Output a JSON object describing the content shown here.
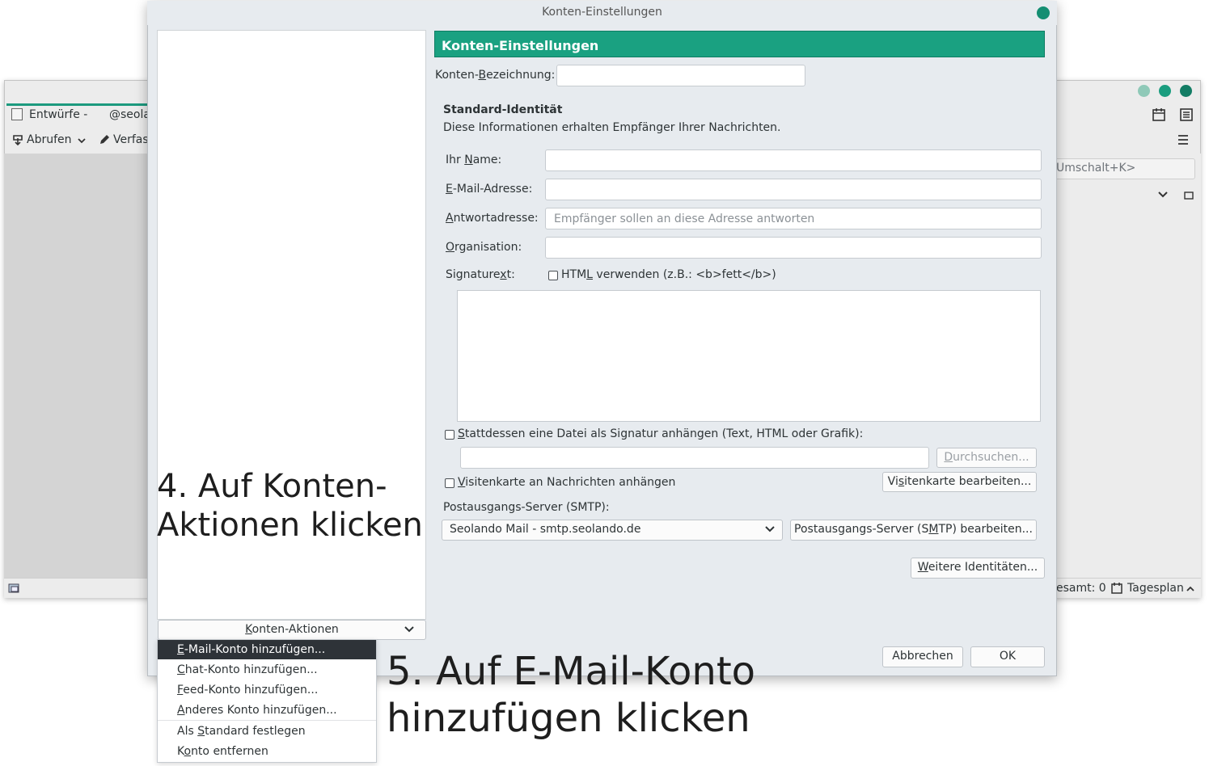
{
  "background_window": {
    "tab_label": "Entwürfe - ",
    "tab_account": "@seola",
    "fetch_label": "Abrufen",
    "compose_label": "Verfas",
    "search_hint": "Umschalt+K>",
    "footer_total": "esamt: 0",
    "footer_today": "Tagesplan"
  },
  "dialog": {
    "title": "Konten-Einstellungen",
    "header": "Konten-Einstellungen",
    "account_name_label_pre": "Konten-",
    "account_name_label_u": "B",
    "account_name_label_post": "ezeichnung:",
    "account_name_value": "",
    "identity_heading": "Standard-Identität",
    "identity_desc": "Diese Informationen erhalten Empfänger Ihrer Nachrichten.",
    "name_label_pre": "Ihr ",
    "name_label_u": "N",
    "name_label_post": "ame:",
    "name_value": "",
    "email_label_u": "E",
    "email_label_post": "-Mail-Adresse:",
    "email_value": "",
    "reply_label_u": "A",
    "reply_label_post": "ntwortadresse:",
    "reply_placeholder": "Empfänger sollen an diese Adresse antworten",
    "org_label_u": "O",
    "org_label_post": "rganisation:",
    "org_value": "",
    "sig_label_pre": "Signature",
    "sig_label_u": "x",
    "sig_label_post": "t:",
    "html_checkbox_pre": "HTM",
    "html_checkbox_u": "L",
    "html_checkbox_post": " verwenden (z.B.: <b>fett</b>)",
    "sig_file_pre": "",
    "sig_file_u": "S",
    "sig_file_post": "tattdessen eine Datei als Signatur anhängen (Text, HTML oder Grafik):",
    "browse_pre": "",
    "browse_u": "D",
    "browse_post": "urchsuchen...",
    "vcard_u": "V",
    "vcard_post": "isitenkarte an Nachrichten anhängen",
    "vcard_edit_pre": "Vi",
    "vcard_edit_u": "s",
    "vcard_edit_post": "itenkarte bearbeiten...",
    "smtp_label": "Postausgangs-Server (SMTP):",
    "smtp_value": "Seolando Mail - smtp.seolando.de",
    "smtp_edit_pre": "Postausgangs-Server (S",
    "smtp_edit_u": "M",
    "smtp_edit_post": "TP) bearbeiten...",
    "more_identities_u": "W",
    "more_identities_post": "eitere Identitäten...",
    "account_actions_u": "K",
    "account_actions_post": "onten-Aktionen",
    "cancel": "Abbrechen",
    "ok": "OK"
  },
  "menu": {
    "items": [
      {
        "u": "E",
        "rest": "-Mail-Konto hinzufügen...",
        "selected": true
      },
      {
        "u": "C",
        "rest": "hat-Konto hinzufügen...",
        "selected": false
      },
      {
        "u": "F",
        "rest": "eed-Konto hinzufügen...",
        "selected": false
      },
      {
        "u": "A",
        "rest": "nderes Konto hinzufügen...",
        "selected": false
      },
      {
        "pre": "Als ",
        "u": "S",
        "rest": "tandard festlegen",
        "selected": false
      },
      {
        "pre": "K",
        "u": "o",
        "rest": "nto entfernen",
        "selected": false
      }
    ]
  },
  "annotations": {
    "step4_line1": "4. Auf Konten-",
    "step4_line2": "Aktionen klicken",
    "step5_line1": "5. Auf E-Mail-Konto",
    "step5_line2": "hinzufügen klicken"
  },
  "colors": {
    "accent": "#1aa181",
    "window_button": "#148e72",
    "menu_selected": "#2e3338"
  }
}
